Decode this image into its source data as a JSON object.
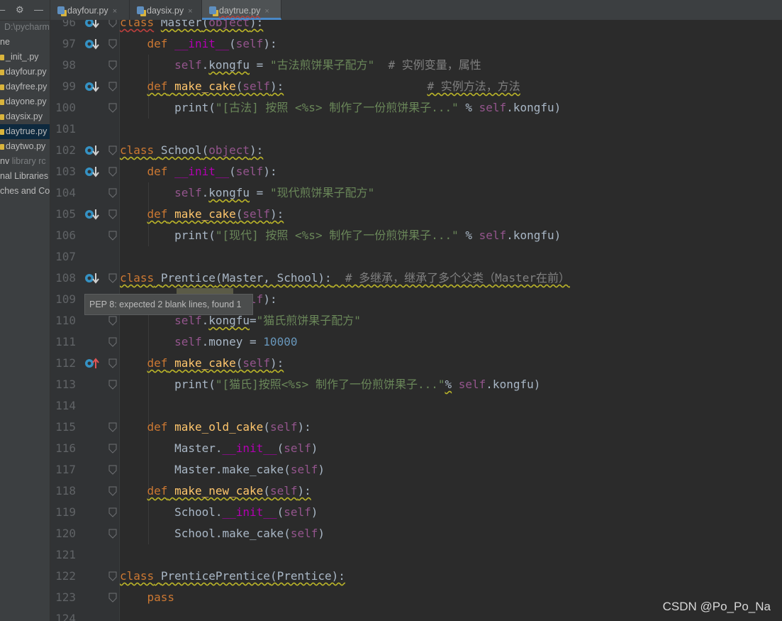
{
  "sidebar": {
    "path_text": "D:\\pycharm",
    "items": [
      {
        "label": "ne"
      },
      {
        "label": "_init_.py"
      },
      {
        "label": "dayfour.py"
      },
      {
        "label": "dayfree.py"
      },
      {
        "label": "dayone.py"
      },
      {
        "label": "daysix.py"
      },
      {
        "label": "daytrue.py"
      },
      {
        "label": "daytwo.py"
      },
      {
        "label": "nv",
        "suffix": "library rc"
      },
      {
        "label": "nal Libraries"
      },
      {
        "label": "ches and Co"
      }
    ]
  },
  "tabs": [
    {
      "label": "dayfour.py",
      "close": "×"
    },
    {
      "label": "daysix.py",
      "close": "×"
    },
    {
      "label": "daytrue.py",
      "close": "×"
    }
  ],
  "editor": {
    "line_numbers": [
      "96",
      "97",
      "98",
      "99",
      "100",
      "101",
      "102",
      "103",
      "104",
      "105",
      "106",
      "107",
      "108",
      "109",
      "110",
      "111",
      "112",
      "113",
      "114",
      "115",
      "116",
      "117",
      "118",
      "119",
      "120",
      "121",
      "122",
      "123",
      "124"
    ],
    "lines": [
      [
        {
          "t": "class",
          "c": "kw warn-red"
        },
        {
          "t": " "
        },
        {
          "t": "Master",
          "c": "plain warn"
        },
        {
          "t": "(",
          "c": "warn"
        },
        {
          "t": "object",
          "c": "self warn"
        },
        {
          "t": "):",
          "c": "warn"
        }
      ],
      [
        {
          "t": "    "
        },
        {
          "t": "def",
          "c": "kw"
        },
        {
          "t": " "
        },
        {
          "t": "__init__",
          "c": "magic"
        },
        {
          "t": "("
        },
        {
          "t": "self",
          "c": "self"
        },
        {
          "t": "):"
        }
      ],
      [
        {
          "t": "        "
        },
        {
          "t": "self",
          "c": "self"
        },
        {
          "t": "."
        },
        {
          "t": "kongfu",
          "c": "warn"
        },
        {
          "t": " = "
        },
        {
          "t": "\"古法煎饼果子配方\"",
          "c": "str"
        },
        {
          "t": "  "
        },
        {
          "t": "# 实例变量，属性",
          "c": "cmt"
        }
      ],
      [
        {
          "t": "    "
        },
        {
          "t": "def",
          "c": "kw warn"
        },
        {
          "t": " ",
          "c": "warn"
        },
        {
          "t": "make_cake",
          "c": "fn warn"
        },
        {
          "t": "(",
          "c": "warn"
        },
        {
          "t": "self",
          "c": "self warn"
        },
        {
          "t": "):",
          "c": "warn"
        },
        {
          "t": "                     "
        },
        {
          "t": "# 实例方法，方法",
          "c": "cmt warn"
        }
      ],
      [
        {
          "t": "        "
        },
        {
          "t": "print"
        },
        {
          "t": "("
        },
        {
          "t": "\"[古法] 按照 <%s> 制作了一份煎饼果子...\"",
          "c": "str"
        },
        {
          "t": " % "
        },
        {
          "t": "self",
          "c": "self"
        },
        {
          "t": ".kongfu)"
        }
      ],
      [],
      [
        {
          "t": "class",
          "c": "kw warn"
        },
        {
          "t": " ",
          "c": "warn"
        },
        {
          "t": "School",
          "c": "plain warn"
        },
        {
          "t": "(",
          "c": "warn"
        },
        {
          "t": "object",
          "c": "self warn"
        },
        {
          "t": "):",
          "c": "warn"
        }
      ],
      [
        {
          "t": "    "
        },
        {
          "t": "def",
          "c": "kw"
        },
        {
          "t": " "
        },
        {
          "t": "__init__",
          "c": "magic"
        },
        {
          "t": "("
        },
        {
          "t": "self",
          "c": "self"
        },
        {
          "t": "):"
        }
      ],
      [
        {
          "t": "        "
        },
        {
          "t": "self",
          "c": "self"
        },
        {
          "t": "."
        },
        {
          "t": "kongfu",
          "c": "warn"
        },
        {
          "t": " = "
        },
        {
          "t": "\"现代煎饼果子配方\"",
          "c": "str"
        }
      ],
      [
        {
          "t": "    "
        },
        {
          "t": "def",
          "c": "kw warn"
        },
        {
          "t": " ",
          "c": "warn"
        },
        {
          "t": "make_cake",
          "c": "fn warn"
        },
        {
          "t": "(",
          "c": "warn"
        },
        {
          "t": "self",
          "c": "self warn"
        },
        {
          "t": "):",
          "c": "warn"
        }
      ],
      [
        {
          "t": "        "
        },
        {
          "t": "print"
        },
        {
          "t": "("
        },
        {
          "t": "\"[现代] 按照 <%s> 制作了一份煎饼果子...\"",
          "c": "str"
        },
        {
          "t": " % "
        },
        {
          "t": "self",
          "c": "self"
        },
        {
          "t": ".kongfu)"
        }
      ],
      [],
      [
        {
          "t": "class",
          "c": "kw warn"
        },
        {
          "t": " ",
          "c": "warn"
        },
        {
          "t": "Prentice",
          "c": "plain warn"
        },
        {
          "t": "(Master, School):",
          "c": "warn"
        },
        {
          "t": "  # 多继承，继承了多个父类（Master在前）",
          "c": "cmt warn"
        }
      ],
      [
        {
          "t": "    "
        },
        {
          "t": "def",
          "c": "kw"
        },
        {
          "t": " "
        },
        {
          "t": "__init__",
          "c": "magic"
        },
        {
          "t": "("
        },
        {
          "t": "self",
          "c": "self"
        },
        {
          "t": "):"
        }
      ],
      [
        {
          "t": "        "
        },
        {
          "t": "self",
          "c": "self"
        },
        {
          "t": "."
        },
        {
          "t": "kongfu",
          "c": "warn"
        },
        {
          "t": "="
        },
        {
          "t": "\"猫氏煎饼果子配方\"",
          "c": "str"
        }
      ],
      [
        {
          "t": "        "
        },
        {
          "t": "self",
          "c": "self"
        },
        {
          "t": ".money = "
        },
        {
          "t": "10000",
          "c": "num"
        }
      ],
      [
        {
          "t": "    "
        },
        {
          "t": "def",
          "c": "kw warn"
        },
        {
          "t": " ",
          "c": "warn"
        },
        {
          "t": "make_cake",
          "c": "fn warn"
        },
        {
          "t": "(",
          "c": "warn"
        },
        {
          "t": "self",
          "c": "self warn"
        },
        {
          "t": "):",
          "c": "warn"
        }
      ],
      [
        {
          "t": "        "
        },
        {
          "t": "print"
        },
        {
          "t": "("
        },
        {
          "t": "\"[猫氏]按照<%s> 制作了一份煎饼果子...\"",
          "c": "str"
        },
        {
          "t": "%",
          "c": "warn"
        },
        {
          "t": " "
        },
        {
          "t": "self",
          "c": "self"
        },
        {
          "t": ".kongfu)"
        }
      ],
      [],
      [
        {
          "t": "    "
        },
        {
          "t": "def",
          "c": "kw"
        },
        {
          "t": " "
        },
        {
          "t": "make_old_cake",
          "c": "fn"
        },
        {
          "t": "("
        },
        {
          "t": "self",
          "c": "self"
        },
        {
          "t": "):"
        }
      ],
      [
        {
          "t": "        Master."
        },
        {
          "t": "__init__",
          "c": "magic"
        },
        {
          "t": "("
        },
        {
          "t": "self",
          "c": "self"
        },
        {
          "t": ")"
        }
      ],
      [
        {
          "t": "        Master.make_cake("
        },
        {
          "t": "self",
          "c": "self"
        },
        {
          "t": ")"
        }
      ],
      [
        {
          "t": "    "
        },
        {
          "t": "def",
          "c": "kw warn"
        },
        {
          "t": " ",
          "c": "warn"
        },
        {
          "t": "make_new_cake",
          "c": "fn warn"
        },
        {
          "t": "(",
          "c": "warn"
        },
        {
          "t": "self",
          "c": "self warn"
        },
        {
          "t": "):",
          "c": "warn"
        }
      ],
      [
        {
          "t": "        School."
        },
        {
          "t": "__init__",
          "c": "magic"
        },
        {
          "t": "("
        },
        {
          "t": "self",
          "c": "self"
        },
        {
          "t": ")"
        }
      ],
      [
        {
          "t": "        School.make_cake("
        },
        {
          "t": "self",
          "c": "self"
        },
        {
          "t": ")"
        }
      ],
      [],
      [
        {
          "t": "class",
          "c": "kw warn"
        },
        {
          "t": " ",
          "c": "warn"
        },
        {
          "t": "PrenticePrentice",
          "c": "plain warn"
        },
        {
          "t": "(Prentice):",
          "c": "warn"
        }
      ],
      [
        {
          "t": "    "
        },
        {
          "t": "pass",
          "c": "kw"
        }
      ],
      []
    ],
    "override_markers": {
      "0": "down",
      "1": "down",
      "3": "down",
      "6": "down",
      "7": "down",
      "9": "down",
      "12": "down",
      "16": "up"
    },
    "fold_markers": [
      0,
      1,
      2,
      3,
      4,
      6,
      7,
      8,
      9,
      10,
      12,
      13,
      14,
      15,
      16,
      17,
      19,
      20,
      21,
      22,
      23,
      24,
      26,
      27
    ]
  },
  "tooltip": {
    "text": "PEP 8: expected 2 blank lines, found 1"
  },
  "watermark": {
    "text": "CSDN @Po_Po_Na"
  },
  "colors": {
    "background": "#2b2b2b",
    "keyword": "#cc7832",
    "function": "#ffc66d",
    "string": "#6a8759",
    "comment": "#808080",
    "self": "#94558d",
    "number": "#6897bb",
    "magic": "#b200b2"
  }
}
